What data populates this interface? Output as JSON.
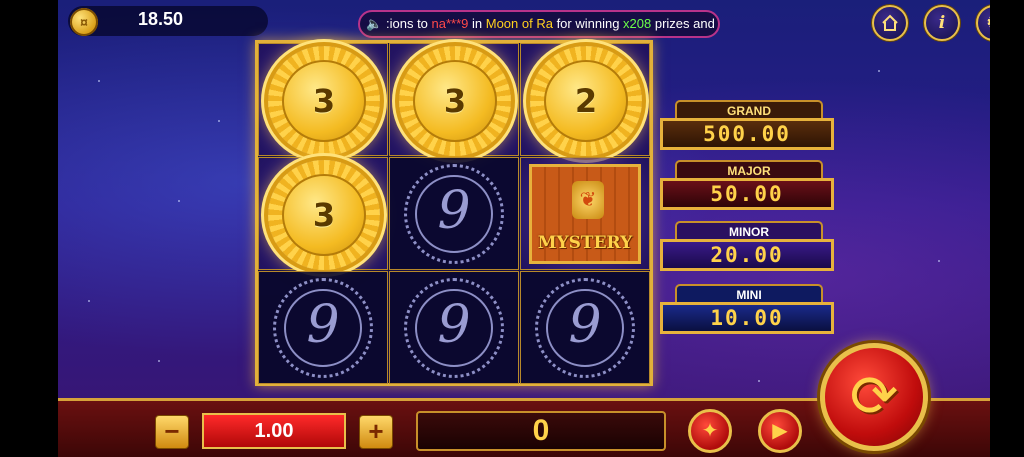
{
  "header": {
    "balance": "18.50",
    "ticker": {
      "part1": ":ions to ",
      "user": "na***9",
      "part2": " in ",
      "game": "Moon of Ra",
      "part3": " for winning ",
      "multiplier": "x208",
      "part4": " prizes and"
    },
    "buttons": [
      "home-icon",
      "info-icon",
      "gear-icon"
    ]
  },
  "grid": {
    "rows": [
      [
        {
          "type": "gold-coin",
          "value": "3"
        },
        {
          "type": "gold-coin",
          "value": "3"
        },
        {
          "type": "gold-coin",
          "value": "2"
        }
      ],
      [
        {
          "type": "gold-coin",
          "value": "3"
        },
        {
          "type": "nine-symbol",
          "value": "9"
        },
        {
          "type": "mystery",
          "value": "MYSTERY"
        }
      ],
      [
        {
          "type": "nine-symbol",
          "value": "9"
        },
        {
          "type": "nine-symbol",
          "value": "9"
        },
        {
          "type": "nine-symbol",
          "value": "9"
        }
      ]
    ]
  },
  "jackpots": {
    "grand": {
      "label": "GRAND",
      "value": "500.00"
    },
    "major": {
      "label": "MAJOR",
      "value": "50.00"
    },
    "minor": {
      "label": "MINOR",
      "value": "20.00"
    },
    "mini": {
      "label": "MINI",
      "value": "10.00"
    }
  },
  "controls": {
    "minus": "−",
    "plus": "+",
    "bet": "1.00",
    "win": "0"
  },
  "colors": {
    "gold": "#e7b23c",
    "red": "#c00c0c",
    "background": "#1a1f7a"
  }
}
